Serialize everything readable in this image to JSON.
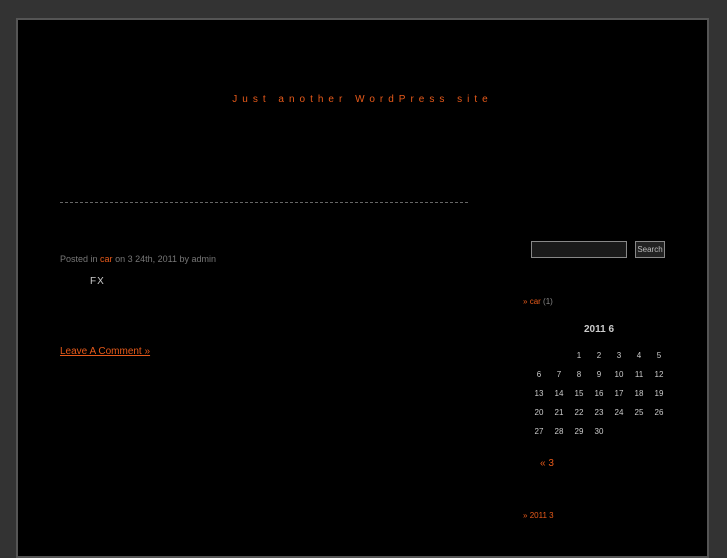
{
  "header": {
    "tagline": "Just another WordPress site"
  },
  "post": {
    "meta": {
      "posted_in": "Posted in",
      "category": "car",
      "date_text": "on 3 24th, 2011 by admin"
    },
    "content": "FX",
    "comment_link": "Leave A Comment »"
  },
  "sidebar": {
    "search": {
      "value": "",
      "button_label": "Search"
    },
    "categories": [
      {
        "prefix": "»",
        "name": "car",
        "count": "(1)"
      }
    ],
    "calendar": {
      "caption": "2011 6",
      "weekday_headers": [
        "",
        "",
        "",
        "",
        "",
        "",
        ""
      ],
      "weeks": [
        [
          "",
          "",
          "1",
          "2",
          "3",
          "4",
          "5"
        ],
        [
          "6",
          "7",
          "8",
          "9",
          "10",
          "11",
          "12"
        ],
        [
          "13",
          "14",
          "15",
          "16",
          "17",
          "18",
          "19"
        ],
        [
          "20",
          "21",
          "22",
          "23",
          "24",
          "25",
          "26"
        ],
        [
          "27",
          "28",
          "29",
          "30",
          "",
          "",
          ""
        ]
      ],
      "prev_link": "« 3"
    },
    "archives": [
      {
        "prefix": "»",
        "label": "2011 3"
      }
    ]
  },
  "colors": {
    "accent": "#e85a1a",
    "background": "#000000",
    "outer_background": "#333333"
  }
}
